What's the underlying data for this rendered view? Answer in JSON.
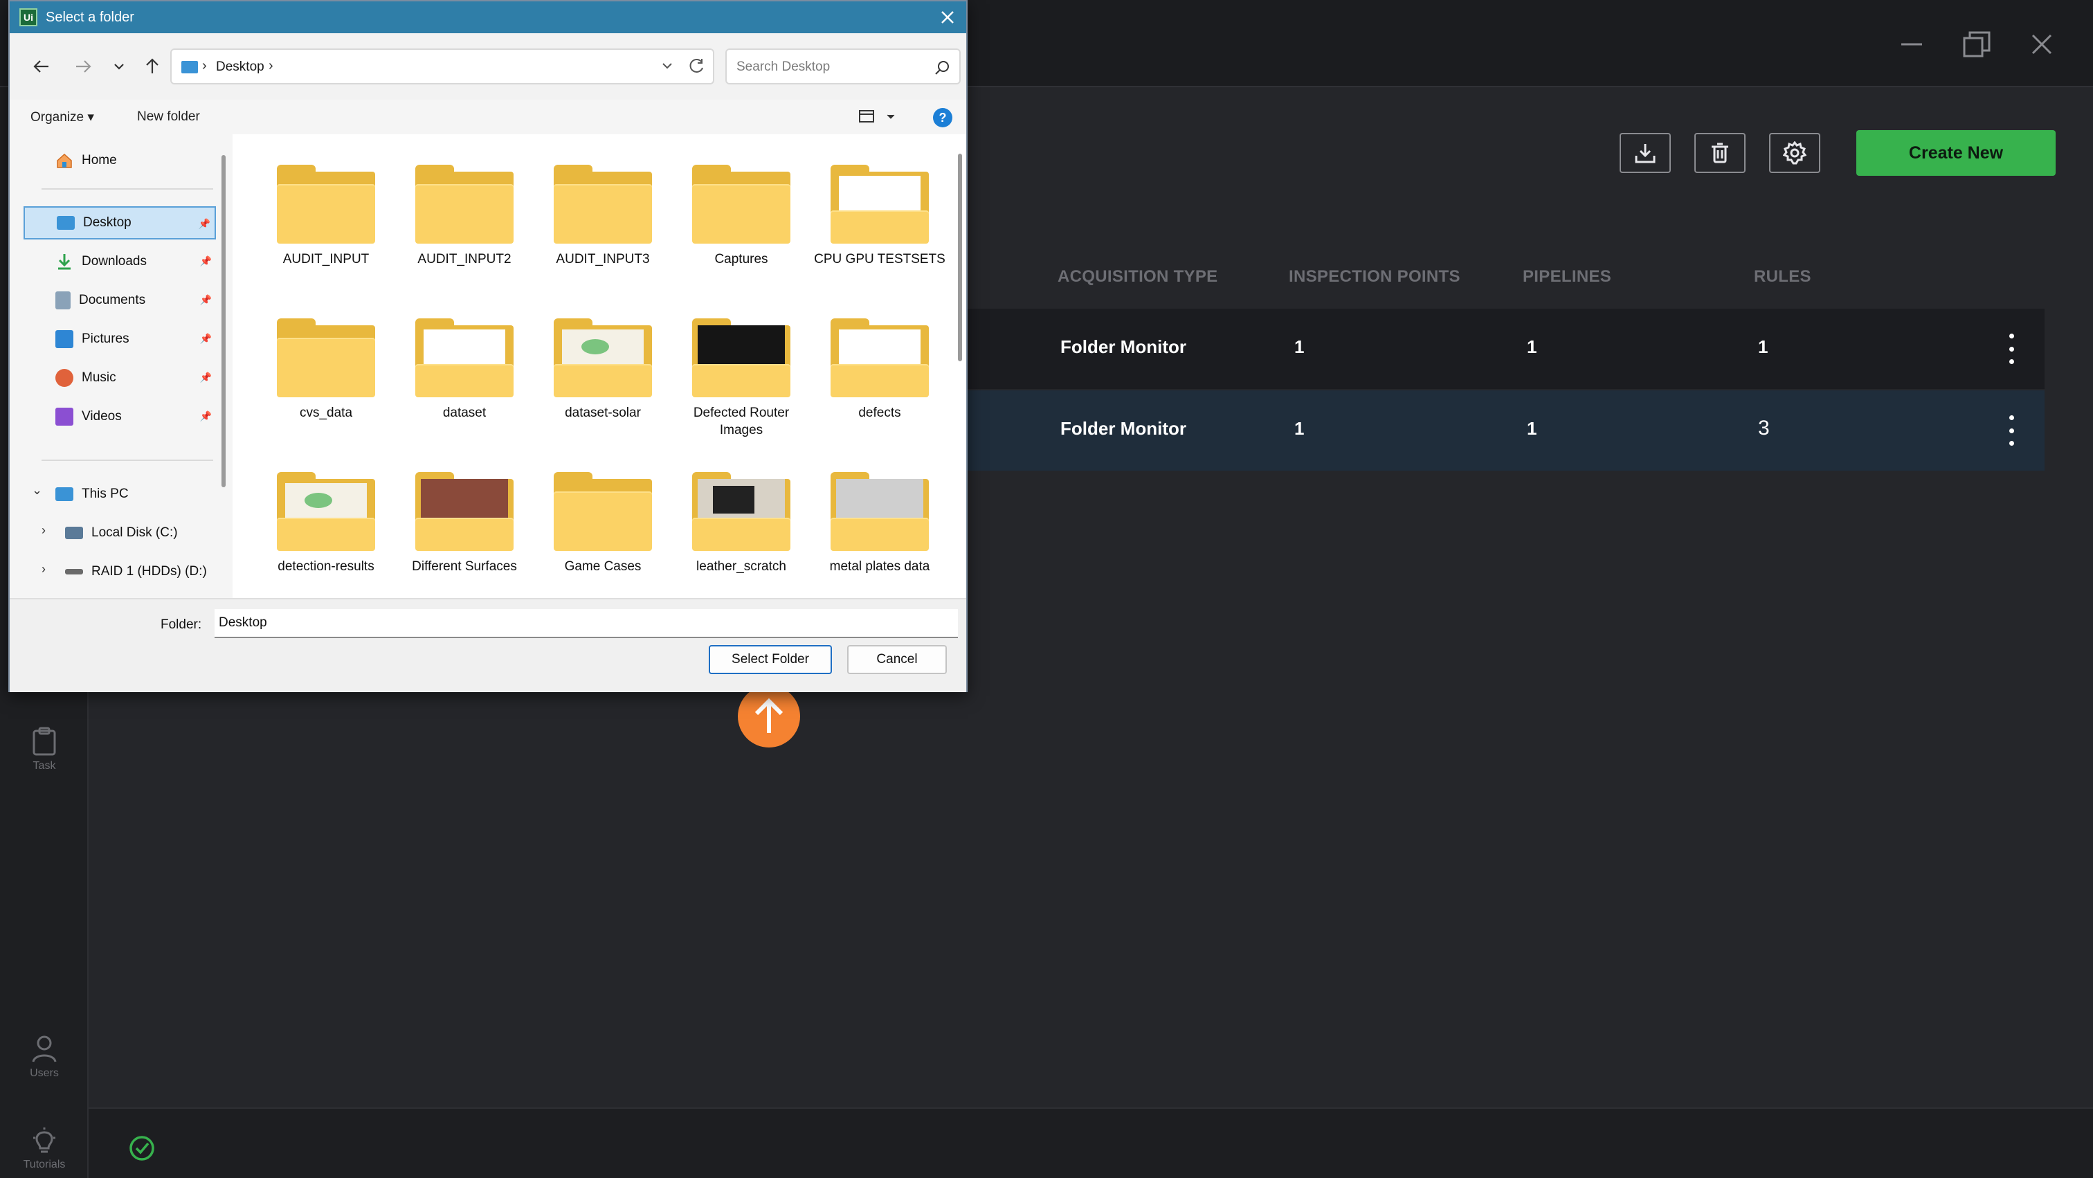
{
  "app": {
    "sidebar": {
      "task_label": "Task",
      "users_label": "Users",
      "tutorials_label": "Tutorials"
    },
    "toolbar": {
      "create_label": "Create New"
    },
    "table": {
      "headers": [
        "ACQUISITION TYPE",
        "INSPECTION POINTS",
        "PIPELINES",
        "RULES"
      ],
      "rows": [
        {
          "acquisition": "Folder Monitor",
          "inspection_points": "1",
          "pipelines": "1",
          "rules": "1"
        },
        {
          "acquisition": "Folder Monitor",
          "inspection_points": "1",
          "pipelines": "1",
          "rules": "3"
        }
      ]
    },
    "colors": {
      "accent_green": "#37b24d",
      "selected_row": "#1f2d3b",
      "marker_orange": "#f58231"
    }
  },
  "dialog": {
    "logo": "Ui",
    "title": "Select a folder",
    "address": {
      "location": "Desktop"
    },
    "search_placeholder": "Search Desktop",
    "commands": {
      "organize": "Organize ▾",
      "new_folder": "New folder"
    },
    "nav": {
      "home": "Home",
      "quick_access": [
        {
          "label": "Desktop",
          "icon": "desktop-icon"
        },
        {
          "label": "Downloads",
          "icon": "download-icon"
        },
        {
          "label": "Documents",
          "icon": "documents-icon"
        },
        {
          "label": "Pictures",
          "icon": "pictures-icon"
        },
        {
          "label": "Music",
          "icon": "music-icon"
        },
        {
          "label": "Videos",
          "icon": "videos-icon"
        }
      ],
      "this_pc": "This PC",
      "drives": [
        "Local Disk (C:)",
        "RAID 1 (HDDs) (D:)"
      ]
    },
    "folders": [
      "AUDIT_INPUT",
      "AUDIT_INPUT2",
      "AUDIT_INPUT3",
      "Captures",
      "CPU GPU TESTSETS",
      "cvs_data",
      "dataset",
      "dataset-solar",
      "Defected Router Images",
      "defects",
      "detection-results",
      "Different Surfaces",
      "Game Cases",
      "leather_scratch",
      "metal plates data"
    ],
    "folder_field": {
      "label": "Folder:",
      "value": "Desktop"
    },
    "buttons": {
      "select": "Select Folder",
      "cancel": "Cancel"
    }
  }
}
